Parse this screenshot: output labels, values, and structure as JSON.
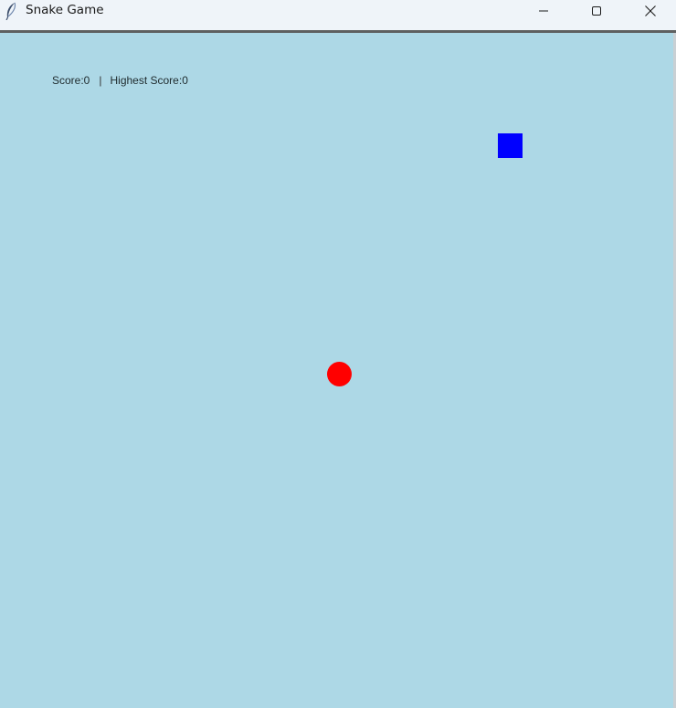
{
  "window": {
    "title": "Snake Game",
    "icon": "feather-icon",
    "controls": {
      "minimize_icon": "minimize-icon",
      "maximize_icon": "maximize-icon",
      "close_icon": "close-icon"
    }
  },
  "game": {
    "score_label": "Score:0",
    "separator": "|",
    "highest_score_label": "Highest Score:0",
    "background_color": "#add8e6",
    "snake_color": "#0000ff",
    "food_color": "#ff0000"
  }
}
